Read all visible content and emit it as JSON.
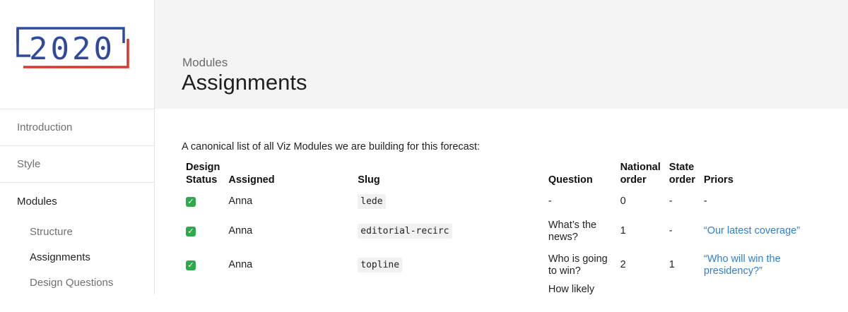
{
  "logo": {
    "text": "2020",
    "colors": {
      "blue": "#2e4aa0",
      "red": "#d9382e"
    }
  },
  "sidebar": {
    "items": [
      {
        "label": "Introduction"
      },
      {
        "label": "Style"
      },
      {
        "label": "Modules"
      }
    ],
    "subitems": [
      {
        "label": "Structure"
      },
      {
        "label": "Assignments",
        "active": true
      },
      {
        "label": "Design Questions"
      }
    ]
  },
  "header": {
    "breadcrumb": "Modules",
    "title": "Assignments"
  },
  "main": {
    "intro": "A canonical list of all Viz Modules we are building for this forecast:",
    "columns": {
      "status_line1": "Design",
      "status_line2": "Status",
      "assigned": "Assigned",
      "slug": "Slug",
      "question": "Question",
      "national_line1": "National",
      "national_line2": "order",
      "state_line1": "State",
      "state_line2": "order",
      "priors": "Priors"
    },
    "rows": [
      {
        "status": "✓",
        "assigned": "Anna",
        "slug": "lede",
        "question": "-",
        "national": "0",
        "state": "-",
        "priors": "-"
      },
      {
        "status": "✓",
        "assigned": "Anna",
        "slug": "editorial-recirc",
        "question": "What’s the news?",
        "national": "1",
        "state": "-",
        "priors": "“Our latest coverage”"
      },
      {
        "status": "✓",
        "assigned": "Anna",
        "slug": "topline",
        "question": "Who is going to win?",
        "national": "2",
        "state": "1",
        "priors": "“Who will win the presidency?”"
      },
      {
        "status": "",
        "assigned": "",
        "slug": "",
        "question": "How likely",
        "national": "",
        "state": "",
        "priors": ""
      }
    ]
  }
}
